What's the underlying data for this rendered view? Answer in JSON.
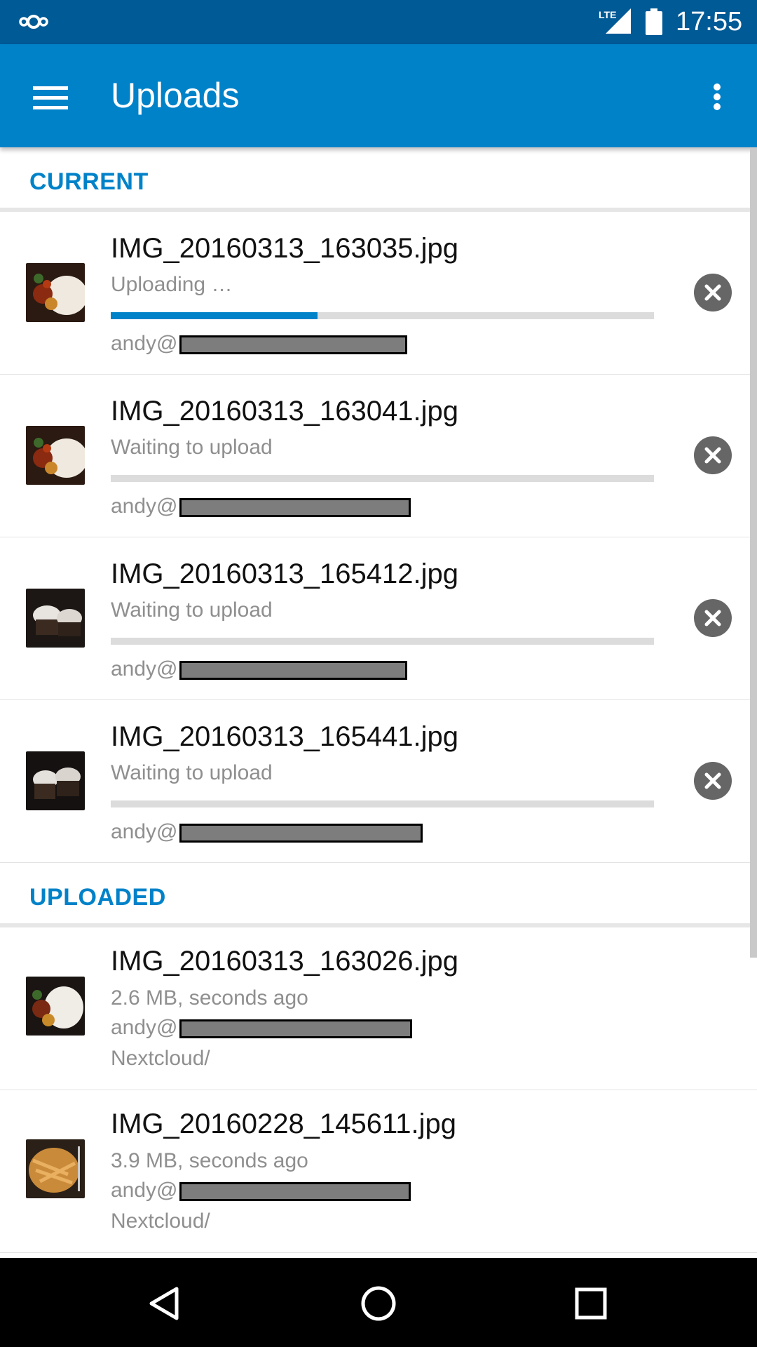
{
  "status_bar": {
    "network": "LTE",
    "time": "17:55",
    "icons": [
      "nextcloud-logo-icon",
      "lte-signal-icon",
      "battery-icon"
    ]
  },
  "app_bar": {
    "title": "Uploads",
    "icons": [
      "menu-icon",
      "more-vert-icon"
    ]
  },
  "sections": {
    "current": {
      "header": "CURRENT",
      "items": [
        {
          "filename": "IMG_20160313_163035.jpg",
          "status": "Uploading …",
          "account": "andy@",
          "progress": 0.38
        },
        {
          "filename": "IMG_20160313_163041.jpg",
          "status": "Waiting to upload",
          "account": "andy@",
          "progress": 0
        },
        {
          "filename": "IMG_20160313_165412.jpg",
          "status": "Waiting to upload",
          "account": "andy@",
          "progress": 0
        },
        {
          "filename": "IMG_20160313_165441.jpg",
          "status": "Waiting to upload",
          "account": "andy@",
          "progress": 0
        }
      ]
    },
    "uploaded": {
      "header": "UPLOADED",
      "items": [
        {
          "filename": "IMG_20160313_163026.jpg",
          "size": "2.6 MB,  seconds ago",
          "account": "andy@",
          "folder": "Nextcloud/"
        },
        {
          "filename": "IMG_20160228_145611.jpg",
          "size": "3.9 MB,  seconds ago",
          "account": "andy@",
          "folder": "Nextcloud/"
        }
      ]
    }
  },
  "nav_bar": {
    "icons": [
      "back-icon",
      "home-icon",
      "recents-icon"
    ]
  },
  "colors": {
    "primary": "#0082c9",
    "status_bar": "#005a96",
    "progress_track": "#dcdcdc",
    "secondary_text": "#8f8f8f"
  }
}
